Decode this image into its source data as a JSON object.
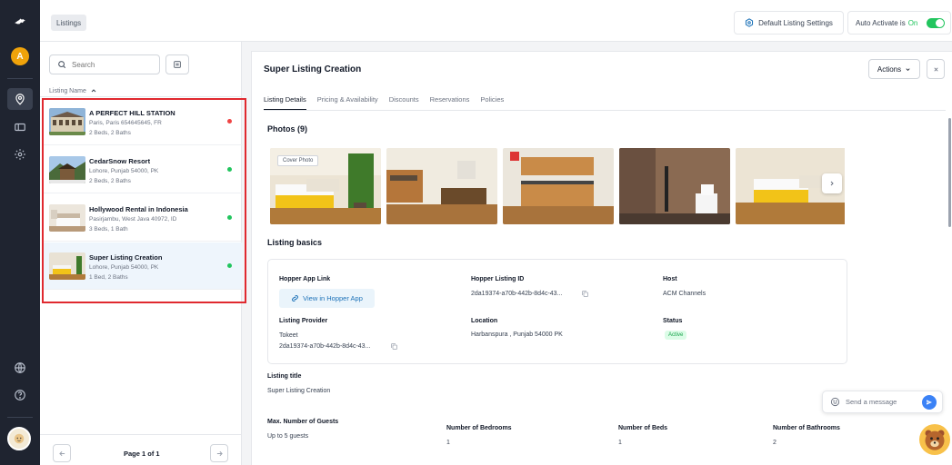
{
  "topbar": {
    "breadcrumb": "Listings",
    "default_settings_label": "Default Listing Settings",
    "auto_activate_label": "Auto Activate is",
    "auto_activate_state": "On"
  },
  "rail": {
    "avatar_letter": "A"
  },
  "listing_panel": {
    "search_placeholder": "Search",
    "column_header": "Listing Name",
    "items": [
      {
        "name": "A PERFECT HILL STATION",
        "address": "Paris, Paris 654645645, FR",
        "meta": "2 Beds, 2 Baths",
        "status_color": "#ef4444"
      },
      {
        "name": "CedarSnow Resort",
        "address": "Lohore, Punjab 54000, PK",
        "meta": "2 Beds, 2 Baths",
        "status_color": "#22c55e"
      },
      {
        "name": "Hollywood Rental in Indonesia",
        "address": "Pasirjambu, West Java 40972, ID",
        "meta": "3 Beds, 1 Bath",
        "status_color": "#22c55e"
      },
      {
        "name": "Super Listing Creation",
        "address": "Lohore, Punjab 54000, PK",
        "meta": "1 Bed, 2 Baths",
        "status_color": "#22c55e"
      }
    ],
    "pager_text": "Page 1 of 1"
  },
  "main": {
    "title": "Super Listing Creation",
    "actions_label": "Actions",
    "tabs": [
      "Listing Details",
      "Pricing & Availability",
      "Discounts",
      "Reservations",
      "Policies"
    ],
    "photos_heading": "Photos (9)",
    "cover_photo_tag": "Cover Photo",
    "basics_heading": "Listing basics",
    "fields": {
      "hopper_app_link_label": "Hopper App Link",
      "view_in_hopper_label": "View in Hopper App",
      "hopper_listing_id_label": "Hopper Listing ID",
      "hopper_listing_id_value": "2da19374-a70b-442b-8d4c-43...",
      "host_label": "Host",
      "host_value": "ACM Channels",
      "listing_provider_label": "Listing Provider",
      "listing_provider_value": "Tokeet",
      "listing_provider_id": "2da19374-a70b-442b-8d4c-43...",
      "location_label": "Location",
      "location_value": "Harbanspura , Punjab 54000 PK",
      "status_label": "Status",
      "status_value": "Active"
    },
    "listing_title_label": "Listing title",
    "listing_title_value": "Super Listing Creation",
    "max_guests_label": "Max. Number of Guests",
    "max_guests_value": "Up to 5 guests",
    "bedrooms_label": "Number of Bedrooms",
    "bedrooms_value": "1",
    "beds_label": "Number of Beds",
    "beds_value": "1",
    "bathrooms_label": "Number of Bathrooms",
    "bathrooms_value": "2"
  },
  "chat": {
    "placeholder": "Send a message"
  },
  "colors": {
    "accent": "#1d72b8",
    "toggle_on": "#22c55e",
    "highlight_border": "#e0292f",
    "rail_bg": "#1f2430"
  }
}
